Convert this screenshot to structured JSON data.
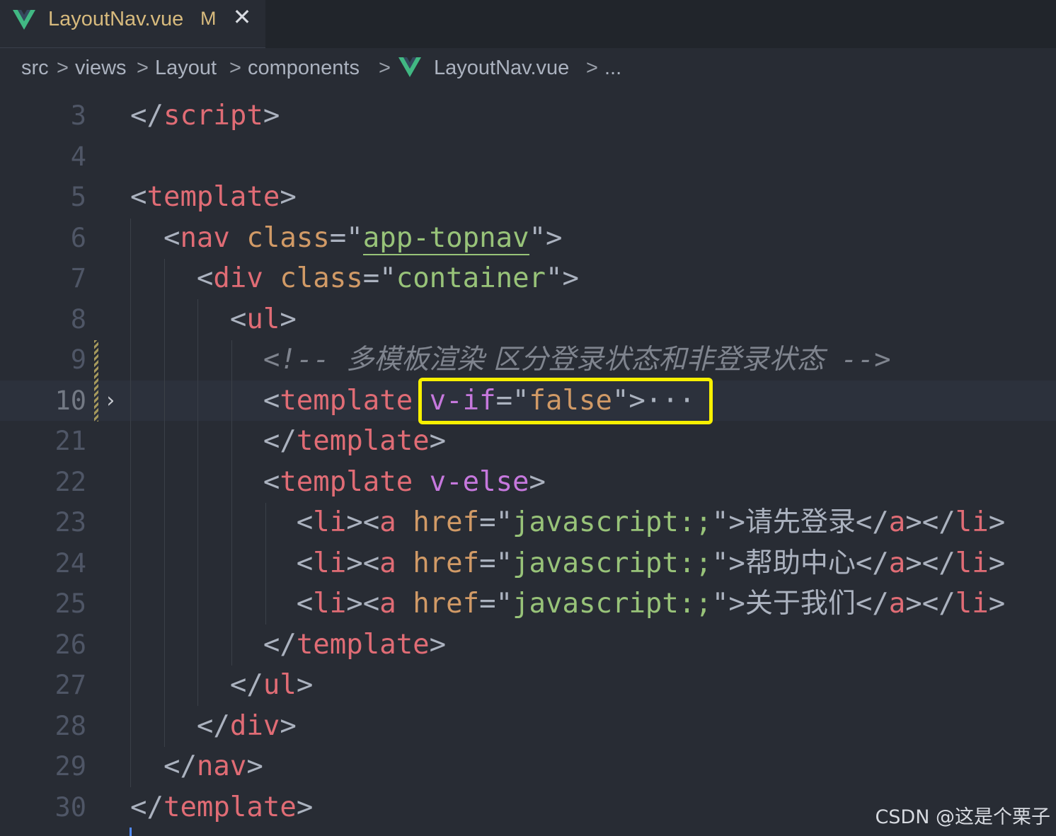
{
  "tab": {
    "filename": "LayoutNav.vue",
    "status": "M",
    "close": "✕",
    "icon": "vue-icon",
    "accent": "#41b883"
  },
  "breadcrumb": [
    "src",
    "views",
    "Layout",
    "components",
    "LayoutNav.vue",
    "..."
  ],
  "breadcrumb_sep": ">",
  "code_lines": [
    {
      "n": "3",
      "tokens": [
        [
          "p",
          "</"
        ],
        [
          "tag",
          "script"
        ],
        [
          "p",
          ">"
        ]
      ]
    },
    {
      "n": "4",
      "tokens": []
    },
    {
      "n": "5",
      "tokens": [
        [
          "p",
          "<"
        ],
        [
          "tag",
          "template"
        ],
        [
          "p",
          ">"
        ]
      ]
    },
    {
      "n": "6",
      "tokens": [
        [
          "p",
          "  <"
        ],
        [
          "tag",
          "nav"
        ],
        [
          "p",
          " "
        ],
        [
          "attr",
          "class"
        ],
        [
          "p",
          "=\""
        ],
        [
          "str",
          "app-topnav"
        ],
        [
          "p",
          "\">"
        ]
      ]
    },
    {
      "n": "7",
      "tokens": [
        [
          "p",
          "    <"
        ],
        [
          "tag",
          "div"
        ],
        [
          "p",
          " "
        ],
        [
          "attr",
          "class"
        ],
        [
          "p",
          "=\""
        ],
        [
          "str",
          "container"
        ],
        [
          "p",
          "\">"
        ]
      ]
    },
    {
      "n": "8",
      "tokens": [
        [
          "p",
          "      <"
        ],
        [
          "tag",
          "ul"
        ],
        [
          "p",
          ">"
        ]
      ]
    },
    {
      "n": "9",
      "tokens": [
        [
          "cmt",
          "        <!-- "
        ],
        [
          "cmt",
          "多模板渲染 区分登录状态和非登录状态"
        ],
        [
          "cmt",
          " -->"
        ]
      ]
    },
    {
      "n": "10",
      "tokens": [
        [
          "p",
          "        <"
        ],
        [
          "tag",
          "template"
        ],
        [
          "p",
          " "
        ],
        [
          "dir",
          "v-if"
        ],
        [
          "p",
          "=\""
        ],
        [
          "attr",
          "false"
        ],
        [
          "p",
          "\">"
        ],
        [
          "p",
          "···"
        ]
      ]
    },
    {
      "n": "21",
      "tokens": [
        [
          "p",
          "        </"
        ],
        [
          "tag",
          "template"
        ],
        [
          "p",
          ">"
        ]
      ]
    },
    {
      "n": "22",
      "tokens": [
        [
          "p",
          "        <"
        ],
        [
          "tag",
          "template"
        ],
        [
          "p",
          " "
        ],
        [
          "dir",
          "v-else"
        ],
        [
          "p",
          ">"
        ]
      ]
    },
    {
      "n": "23",
      "tokens": [
        [
          "p",
          "          <"
        ],
        [
          "tag",
          "li"
        ],
        [
          "p",
          "><"
        ],
        [
          "tag",
          "a"
        ],
        [
          "p",
          " "
        ],
        [
          "attr",
          "href"
        ],
        [
          "p",
          "=\""
        ],
        [
          "str",
          "javascript:;"
        ],
        [
          "p",
          "\">"
        ],
        [
          "txt",
          "请先登录"
        ],
        [
          "p",
          "</"
        ],
        [
          "tag",
          "a"
        ],
        [
          "p",
          "></"
        ],
        [
          "tag",
          "li"
        ],
        [
          "p",
          ">"
        ]
      ]
    },
    {
      "n": "24",
      "tokens": [
        [
          "p",
          "          <"
        ],
        [
          "tag",
          "li"
        ],
        [
          "p",
          "><"
        ],
        [
          "tag",
          "a"
        ],
        [
          "p",
          " "
        ],
        [
          "attr",
          "href"
        ],
        [
          "p",
          "=\""
        ],
        [
          "str",
          "javascript:;"
        ],
        [
          "p",
          "\">"
        ],
        [
          "txt",
          "帮助中心"
        ],
        [
          "p",
          "</"
        ],
        [
          "tag",
          "a"
        ],
        [
          "p",
          "></"
        ],
        [
          "tag",
          "li"
        ],
        [
          "p",
          ">"
        ]
      ]
    },
    {
      "n": "25",
      "tokens": [
        [
          "p",
          "          <"
        ],
        [
          "tag",
          "li"
        ],
        [
          "p",
          "><"
        ],
        [
          "tag",
          "a"
        ],
        [
          "p",
          " "
        ],
        [
          "attr",
          "href"
        ],
        [
          "p",
          "=\""
        ],
        [
          "str",
          "javascript:;"
        ],
        [
          "p",
          "\">"
        ],
        [
          "txt",
          "关于我们"
        ],
        [
          "p",
          "</"
        ],
        [
          "tag",
          "a"
        ],
        [
          "p",
          "></"
        ],
        [
          "tag",
          "li"
        ],
        [
          "p",
          ">"
        ]
      ]
    },
    {
      "n": "26",
      "tokens": [
        [
          "p",
          "        </"
        ],
        [
          "tag",
          "template"
        ],
        [
          "p",
          ">"
        ]
      ]
    },
    {
      "n": "27",
      "tokens": [
        [
          "p",
          "      </"
        ],
        [
          "tag",
          "ul"
        ],
        [
          "p",
          ">"
        ]
      ]
    },
    {
      "n": "28",
      "tokens": [
        [
          "p",
          "    </"
        ],
        [
          "tag",
          "div"
        ],
        [
          "p",
          ">"
        ]
      ]
    },
    {
      "n": "29",
      "tokens": [
        [
          "p",
          "  </"
        ],
        [
          "tag",
          "nav"
        ],
        [
          "p",
          ">"
        ]
      ]
    },
    {
      "n": "30",
      "tokens": [
        [
          "p",
          "</"
        ],
        [
          "tag",
          "template"
        ],
        [
          "p",
          ">"
        ]
      ]
    }
  ],
  "current_line": "10",
  "fold_icon": "chevron-right-icon",
  "watermark": "CSDN @这是个栗子",
  "colors": {
    "background": "#282c34",
    "tag": "#e06c75",
    "attribute": "#d19a66",
    "string": "#98c379",
    "directive": "#c678dd",
    "comment": "#7f848e",
    "highlight_box": "#f7f000"
  }
}
